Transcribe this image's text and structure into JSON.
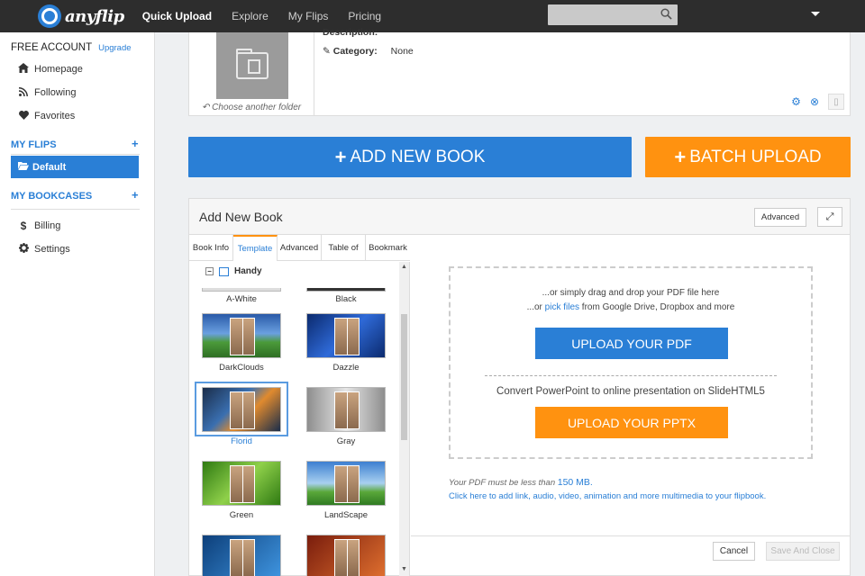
{
  "topbar": {
    "logo_text": "anyflip",
    "nav": [
      "Quick Upload",
      "Explore",
      "My Flips",
      "Pricing"
    ]
  },
  "sidebar": {
    "account_label": "FREE ACCOUNT",
    "upgrade_label": "Upgrade",
    "top_items": [
      {
        "label": "Homepage",
        "icon": "home-icon"
      },
      {
        "label": "Following",
        "icon": "rss-icon"
      },
      {
        "label": "Favorites",
        "icon": "heart-icon"
      }
    ],
    "my_flips_label": "MY FLIPS",
    "default_label": "Default",
    "my_bookcases_label": "MY BOOKCASES",
    "bottom_items": [
      {
        "label": "Billing",
        "icon": "dollar-icon"
      },
      {
        "label": "Settings",
        "icon": "gear-icon"
      }
    ]
  },
  "folder": {
    "choose_label": "Choose another folder",
    "description_label": "Description:",
    "category_label": "Category:",
    "category_value": "None"
  },
  "actions": {
    "add_new_book": "ADD NEW BOOK",
    "batch_upload": "BATCH UPLOAD"
  },
  "add_book_panel": {
    "title": "Add New Book",
    "advanced_label": "Advanced",
    "tabs": [
      "Book Info",
      "Template",
      "Advanced",
      "Table of",
      "Bookmark"
    ],
    "active_tab": "Template",
    "group_label": "Handy",
    "templates": [
      {
        "name": "A-White"
      },
      {
        "name": "Black"
      },
      {
        "name": "DarkClouds"
      },
      {
        "name": "Dazzle"
      },
      {
        "name": "Florid"
      },
      {
        "name": "Gray"
      },
      {
        "name": "Green"
      },
      {
        "name": "LandScape"
      }
    ],
    "selected_template": "Florid",
    "upload": {
      "drag_line": "...or simply drag and drop your PDF file here",
      "pick_prefix": "...or ",
      "pick_link": "pick files",
      "pick_suffix": " from Google Drive, Dropbox and more",
      "pdf_button": "UPLOAD YOUR PDF",
      "convert_line": "Convert PowerPoint to online presentation on SlideHTML5",
      "pptx_button": "UPLOAD YOUR PPTX"
    },
    "size_note_prefix": "Your PDF must be less than ",
    "size_limit": "150 MB.",
    "multimedia_link": "Click here to add link, audio, video, animation and more multimedia to your flipbook.",
    "cancel_label": "Cancel",
    "save_label": "Save And Close"
  },
  "colors": {
    "accent_blue": "#2a7fd6",
    "accent_orange": "#ff9210",
    "topbar_bg": "#2d2d2d"
  }
}
